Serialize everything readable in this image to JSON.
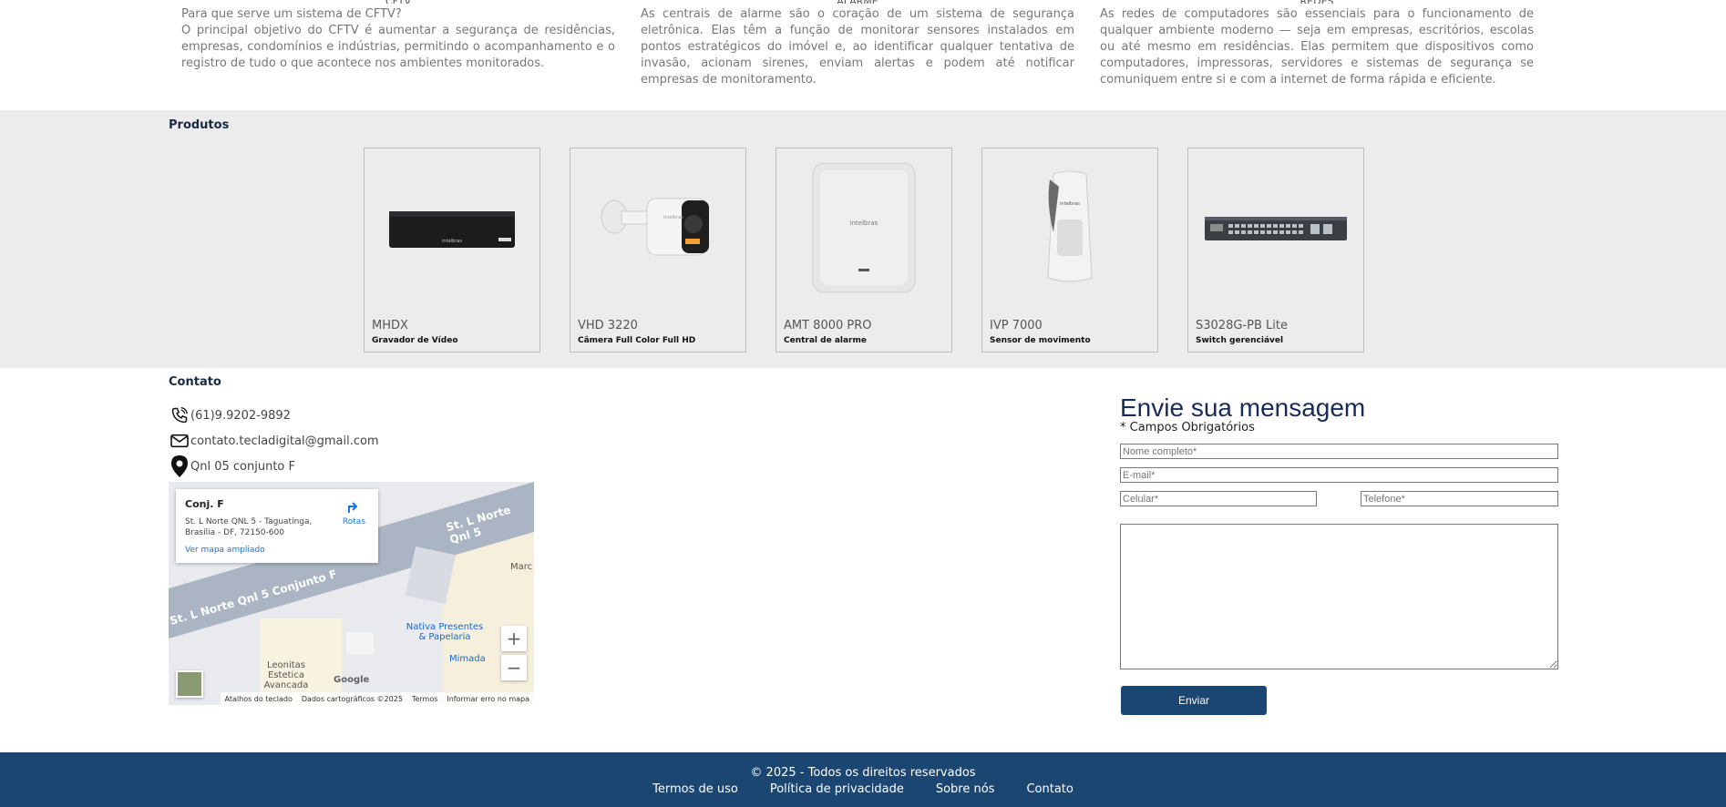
{
  "info": [
    {
      "title": "CFTV",
      "text": "Para que serve um sistema de CFTV?\nO principal objetivo do CFTV é aumentar a segurança de residências, empresas, condomínios e indústrias, permitindo o acompanhamento e o registro de tudo o que acontece nos ambientes monitorados."
    },
    {
      "title": "ALARME",
      "text": "As centrais de alarme são o coração de um sistema de segurança eletrônica. Elas têm a função de monitorar sensores instalados em pontos estratégicos do imóvel e, ao identificar qualquer tentativa de invasão, acionam sirenes, enviam alertas e podem até notificar empresas de monitoramento."
    },
    {
      "title": "REDES",
      "text": "As redes de computadores são essenciais para o funcionamento de qualquer ambiente moderno — seja em empresas, escritórios, escolas ou até mesmo em residências. Elas permitem que dispositivos como computadores, impressoras, servidores e sistemas de segurança se comuniquem entre si e com a internet de forma rápida e eficiente."
    }
  ],
  "products": {
    "title": "Produtos",
    "items": [
      {
        "name": "MHDX",
        "desc": "Gravador de Vídeo",
        "icon": "dvr-recorder-image"
      },
      {
        "name": "VHD 3220",
        "desc": "Câmera Full Color Full HD",
        "icon": "bullet-camera-image"
      },
      {
        "name": "AMT 8000 PRO",
        "desc": "Central de alarme",
        "icon": "alarm-panel-image"
      },
      {
        "name": "IVP 7000",
        "desc": "Sensor de movimento",
        "icon": "motion-sensor-image"
      },
      {
        "name": "S3028G-PB Lite",
        "desc": "Switch gerenciável",
        "icon": "network-switch-image"
      }
    ],
    "brand": "intelbras"
  },
  "contact": {
    "title": "Contato",
    "phone": "(61)9.9202-9892",
    "email": "contato.tecladigital@gmail.com",
    "address": "Qnl 05 conjunto F"
  },
  "map": {
    "place_title": "Conj. F",
    "place_address": "St. L Norte QNL 5 - Taguatinga, Brasília - DF, 72150-600",
    "directions_label": "Rotas",
    "larger_map_link": "Ver mapa ampliado",
    "street1": "St. L Norte Qnl 5",
    "street2": "St. L Norte Qnl 5 Conjunto F",
    "poi1": "Nativa Presentes & Papelaria",
    "poi2": "Mimada",
    "poi3": "Leonitas Estetica Avancada",
    "poi4": "Marc",
    "zoom_in": "+",
    "zoom_out": "−",
    "google": "Google",
    "footer": [
      "Atalhos do teclado",
      "Dados cartográficos ©2025",
      "Termos",
      "Informar erro no mapa"
    ]
  },
  "form": {
    "title": "Envie sua mensagem",
    "required_note": "* Campos Obrigatórios",
    "name_placeholder": "Nome completo*",
    "email_placeholder": "E-mail*",
    "cell_placeholder": "Celular*",
    "phone_placeholder": "Telefone*",
    "message_placeholder": "",
    "submit_label": "Enviar"
  },
  "footer": {
    "copyright": "© 2025 - Todos os direitos reservados",
    "links": [
      "Termos de uso",
      "Política de privacidade",
      "Sobre nós",
      "Contato"
    ]
  },
  "colors": {
    "primary": "#1b4672",
    "section_bg": "#ececec",
    "heading": "#1a2a44"
  }
}
